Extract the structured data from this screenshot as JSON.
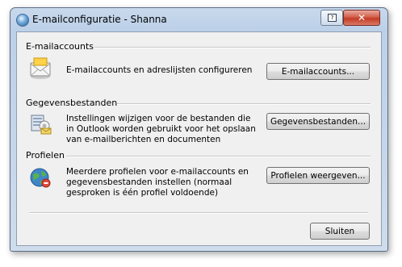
{
  "window": {
    "title": "E-mailconfiguratie - Shanna",
    "help_symbol": "?",
    "close_symbol": "✕"
  },
  "sections": [
    {
      "header": "E-mailaccounts",
      "icon": "mail-envelope-icon",
      "description": "E-mailaccounts en adreslijsten configureren",
      "button_label": "E-mailaccounts..."
    },
    {
      "header": "Gegevensbestanden",
      "icon": "data-files-icon",
      "description": "Instellingen wijzigen voor de bestanden die in Outlook worden gebruikt voor het opslaan van e-mailberichten en documenten",
      "button_label": "Gegevensbestanden..."
    },
    {
      "header": "Profielen",
      "icon": "profiles-icon",
      "description": "Meerdere profielen voor e-mailaccounts en gegevensbestanden instellen (normaal gesproken is één profiel voldoende)",
      "button_label": "Profielen weergeven..."
    }
  ],
  "footer": {
    "close_label": "Sluiten"
  }
}
